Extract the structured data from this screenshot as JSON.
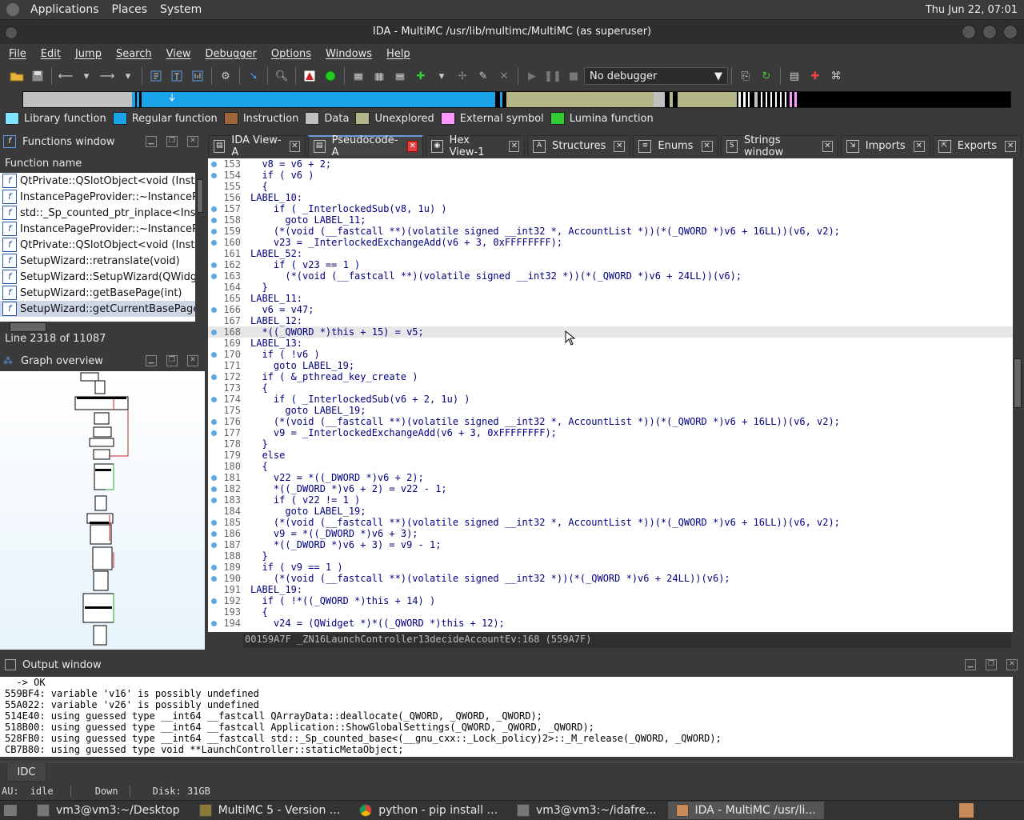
{
  "desktop_panel": {
    "menus": [
      "Applications",
      "Places",
      "System"
    ],
    "clock": "Thu Jun 22, 07:01"
  },
  "window": {
    "title": "IDA - MultiMC /usr/lib/multimc/MultiMC (as superuser)"
  },
  "menubar": [
    "File",
    "Edit",
    "Jump",
    "Search",
    "View",
    "Debugger",
    "Options",
    "Windows",
    "Help"
  ],
  "toolbar": {
    "debugger_selected": "No debugger"
  },
  "legend": [
    {
      "label": "Library function",
      "color": "#80e5ff"
    },
    {
      "label": "Regular function",
      "color": "#1aa3e8"
    },
    {
      "label": "Instruction",
      "color": "#a0643c"
    },
    {
      "label": "Data",
      "color": "#c0c0c0"
    },
    {
      "label": "Unexplored",
      "color": "#b5b58a"
    },
    {
      "label": "External symbol",
      "color": "#ff99ff"
    },
    {
      "label": "Lumina function",
      "color": "#33cc33"
    }
  ],
  "functions_window": {
    "title": "Functions window",
    "column": "Function name",
    "items": [
      "QtPrivate::QSlotObject<void (Instance",
      "InstancePageProvider::~InstancePage",
      "std::_Sp_counted_ptr_inplace<Instan",
      "InstancePageProvider::~InstancePage",
      "QtPrivate::QSlotObject<void (Instance",
      "SetupWizard::retranslate(void)",
      "SetupWizard::SetupWizard(QWidget",
      "SetupWizard::getBasePage(int)",
      "SetupWizard::getCurrentBasePage(vo"
    ],
    "status": "Line 2318 of 11087"
  },
  "graph_overview": {
    "title": "Graph overview"
  },
  "tabs": [
    {
      "label": "IDA View-A",
      "icon": "ida-view-icon"
    },
    {
      "label": "Pseudocode-A",
      "icon": "pseudocode-icon"
    },
    {
      "label": "Hex View-1",
      "icon": "hex-view-icon"
    },
    {
      "label": "Structures",
      "icon": "structures-icon"
    },
    {
      "label": "Enums",
      "icon": "enums-icon"
    },
    {
      "label": "Strings window",
      "icon": "strings-icon"
    },
    {
      "label": "Imports",
      "icon": "imports-icon"
    },
    {
      "label": "Exports",
      "icon": "exports-icon"
    }
  ],
  "code": [
    {
      "n": "153",
      "dot": true,
      "t": "  v8 = v6 + 2;"
    },
    {
      "n": "154",
      "dot": true,
      "t": "  if ( v6 )"
    },
    {
      "n": "155",
      "dot": false,
      "t": "  {"
    },
    {
      "n": "156",
      "dot": false,
      "t": "LABEL_10:"
    },
    {
      "n": "157",
      "dot": true,
      "t": "    if ( _InterlockedSub(v8, 1u) )"
    },
    {
      "n": "158",
      "dot": true,
      "t": "      goto LABEL_11;"
    },
    {
      "n": "159",
      "dot": true,
      "t": "    (*(void (__fastcall **)(volatile signed __int32 *, AccountList *))(*(_QWORD *)v6 + 16LL))(v6, v2);"
    },
    {
      "n": "160",
      "dot": true,
      "t": "    v23 = _InterlockedExchangeAdd(v6 + 3, 0xFFFFFFFF);"
    },
    {
      "n": "161",
      "dot": false,
      "t": "LABEL_52:"
    },
    {
      "n": "162",
      "dot": true,
      "t": "    if ( v23 == 1 )"
    },
    {
      "n": "163",
      "dot": true,
      "t": "      (*(void (__fastcall **)(volatile signed __int32 *))(*(_QWORD *)v6 + 24LL))(v6);"
    },
    {
      "n": "164",
      "dot": false,
      "t": "  }"
    },
    {
      "n": "165",
      "dot": false,
      "t": "LABEL_11:"
    },
    {
      "n": "166",
      "dot": true,
      "t": "  v6 = v47;"
    },
    {
      "n": "167",
      "dot": false,
      "t": "LABEL_12:"
    },
    {
      "n": "168",
      "dot": true,
      "t": "  *((_QWORD *)this + 15) = v5;"
    },
    {
      "n": "169",
      "dot": false,
      "t": "LABEL_13:"
    },
    {
      "n": "170",
      "dot": true,
      "t": "  if ( !v6 )"
    },
    {
      "n": "171",
      "dot": false,
      "t": "    goto LABEL_19;"
    },
    {
      "n": "172",
      "dot": true,
      "t": "  if ( &_pthread_key_create )"
    },
    {
      "n": "173",
      "dot": false,
      "t": "  {"
    },
    {
      "n": "174",
      "dot": true,
      "t": "    if ( _InterlockedSub(v6 + 2, 1u) )"
    },
    {
      "n": "175",
      "dot": false,
      "t": "      goto LABEL_19;"
    },
    {
      "n": "176",
      "dot": true,
      "t": "    (*(void (__fastcall **)(volatile signed __int32 *, AccountList *))(*(_QWORD *)v6 + 16LL))(v6, v2);"
    },
    {
      "n": "177",
      "dot": true,
      "t": "    v9 = _InterlockedExchangeAdd(v6 + 3, 0xFFFFFFFF);"
    },
    {
      "n": "178",
      "dot": false,
      "t": "  }"
    },
    {
      "n": "179",
      "dot": false,
      "t": "  else"
    },
    {
      "n": "180",
      "dot": false,
      "t": "  {"
    },
    {
      "n": "181",
      "dot": true,
      "t": "    v22 = *((_DWORD *)v6 + 2);"
    },
    {
      "n": "182",
      "dot": true,
      "t": "    *((_DWORD *)v6 + 2) = v22 - 1;"
    },
    {
      "n": "183",
      "dot": true,
      "t": "    if ( v22 != 1 )"
    },
    {
      "n": "184",
      "dot": false,
      "t": "      goto LABEL_19;"
    },
    {
      "n": "185",
      "dot": true,
      "t": "    (*(void (__fastcall **)(volatile signed __int32 *, AccountList *))(*(_QWORD *)v6 + 16LL))(v6, v2);"
    },
    {
      "n": "186",
      "dot": true,
      "t": "    v9 = *((_DWORD *)v6 + 3);"
    },
    {
      "n": "187",
      "dot": true,
      "t": "    *((_DWORD *)v6 + 3) = v9 - 1;"
    },
    {
      "n": "188",
      "dot": false,
      "t": "  }"
    },
    {
      "n": "189",
      "dot": true,
      "t": "  if ( v9 == 1 )"
    },
    {
      "n": "190",
      "dot": true,
      "t": "    (*(void (__fastcall **)(volatile signed __int32 *))(*(_QWORD *)v6 + 24LL))(v6);"
    },
    {
      "n": "191",
      "dot": false,
      "t": "LABEL_19:"
    },
    {
      "n": "192",
      "dot": true,
      "t": "  if ( !*((_QWORD *)this + 14) )"
    },
    {
      "n": "193",
      "dot": false,
      "t": "  {"
    },
    {
      "n": "194",
      "dot": true,
      "t": "    v24 = (QWidget *)*((_QWORD *)this + 12);"
    }
  ],
  "code_status": "00159A7F _ZN16LaunchController13decideAccountEv:168 (559A7F)",
  "output_window": {
    "title": "Output window",
    "lines": [
      "  -> OK",
      "559BF4: variable 'v16' is possibly undefined",
      "55A022: variable 'v26' is possibly undefined",
      "514E40: using guessed type __int64 __fastcall QArrayData::deallocate(_QWORD, _QWORD, _QWORD);",
      "518B00: using guessed type __int64 __fastcall Application::ShowGlobalSettings(_QWORD, _QWORD, _QWORD);",
      "528FB0: using guessed type __int64 __fastcall std::_Sp_counted_base<(__gnu_cxx::_Lock_policy)2>::_M_release(_QWORD, _QWORD);",
      "CB7B80: using guessed type void **LaunchController::staticMetaObject;"
    ]
  },
  "idc_button": "IDC",
  "au_status": {
    "au": "AU:",
    "state": "idle",
    "dir": "Down",
    "disk": "Disk: 31GB"
  },
  "taskbar": [
    {
      "label": "vm3@vm3:~/Desktop",
      "active": false
    },
    {
      "label": "MultiMC 5 - Version ...",
      "active": false
    },
    {
      "label": "python - pip install ...",
      "active": false
    },
    {
      "label": "vm3@vm3:~/idafre...",
      "active": false
    },
    {
      "label": "IDA - MultiMC /usr/li...",
      "active": true
    }
  ]
}
